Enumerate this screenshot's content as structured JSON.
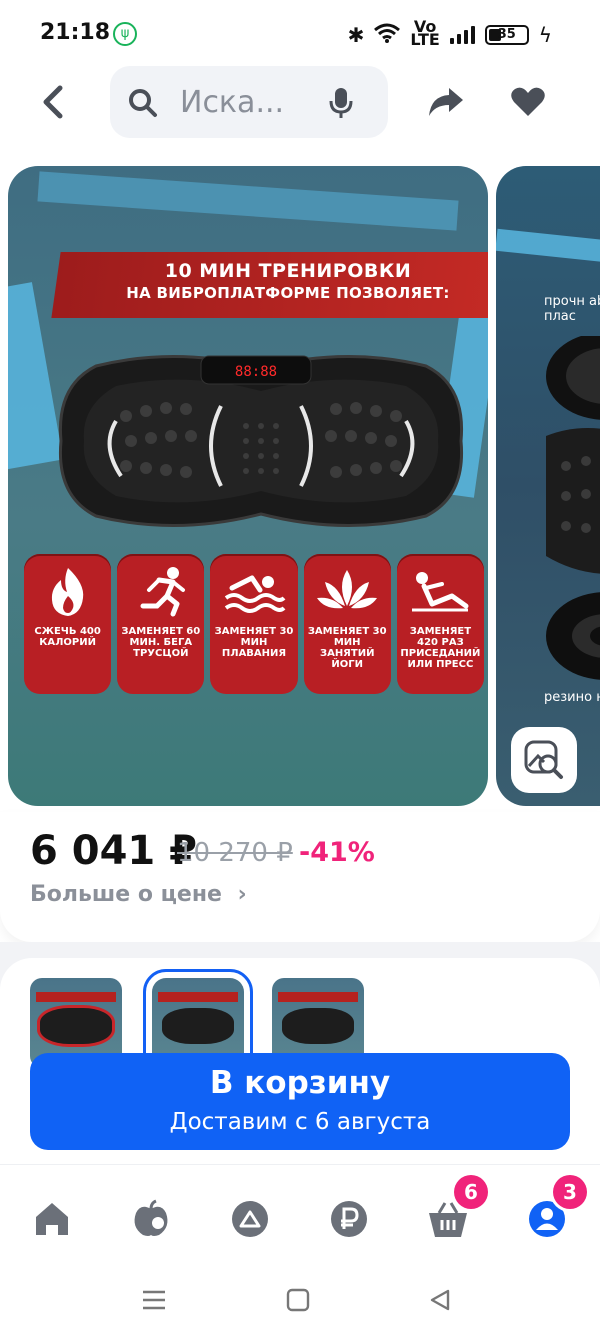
{
  "status_bar": {
    "time": "21:18",
    "battery_level": "35",
    "volte_top": "Vo",
    "volte_bottom": "LTE"
  },
  "header": {
    "search_placeholder": "Иска...",
    "icons": [
      "chevron-left-icon",
      "search-icon",
      "mic-icon",
      "share-icon",
      "heart-icon"
    ]
  },
  "gallery": {
    "banner_line1": "10 МИН ТРЕНИРОВКИ",
    "banner_line2": "НА ВИБРОПЛАТФОРМЕ ПОЗВОЛЯЕТ:",
    "display_digits": "88:88",
    "features": [
      {
        "text": "СЖЕЧЬ 400 КАЛОРИЙ",
        "icon": "flame-icon"
      },
      {
        "text": "ЗАМЕНЯЕТ 60 МИН. БЕГА ТРУСЦОЙ",
        "icon": "runner-icon"
      },
      {
        "text": "ЗАМЕНЯЕТ 30 МИН ПЛАВАНИЯ",
        "icon": "swimmer-icon"
      },
      {
        "text": "ЗАМЕНЯЕТ 30 МИН ЗАНЯТИЙ ЙОГИ",
        "icon": "lotus-icon"
      },
      {
        "text": "ЗАМЕНЯЕТ 420 РАЗ ПРИСЕДАНИЙ ИЛИ ПРЕСС",
        "icon": "situp-icon"
      }
    ],
    "next_slide_text_top": "прочн abc плас",
    "next_slide_text_bottom": "резино нож"
  },
  "price": {
    "current": "6 041 ₽",
    "old": "10 270 ₽",
    "discount": "-41%",
    "more_link": "Больше о цене"
  },
  "cart_button": {
    "label": "В корзину",
    "delivery": "Доставим с 6 августа"
  },
  "tabbar": {
    "items": [
      {
        "name": "home",
        "icon": "home-icon"
      },
      {
        "name": "catalog",
        "icon": "catalog-icon"
      },
      {
        "name": "services",
        "icon": "services-icon"
      },
      {
        "name": "finance",
        "icon": "ruble-icon"
      },
      {
        "name": "cart",
        "icon": "cart-icon",
        "badge": "6"
      },
      {
        "name": "profile",
        "icon": "profile-icon",
        "badge": "3"
      }
    ]
  },
  "colors": {
    "accent": "#1062f5",
    "discount": "#f0237a",
    "badge": "#f0237a",
    "feature_red": "#b81f24"
  }
}
